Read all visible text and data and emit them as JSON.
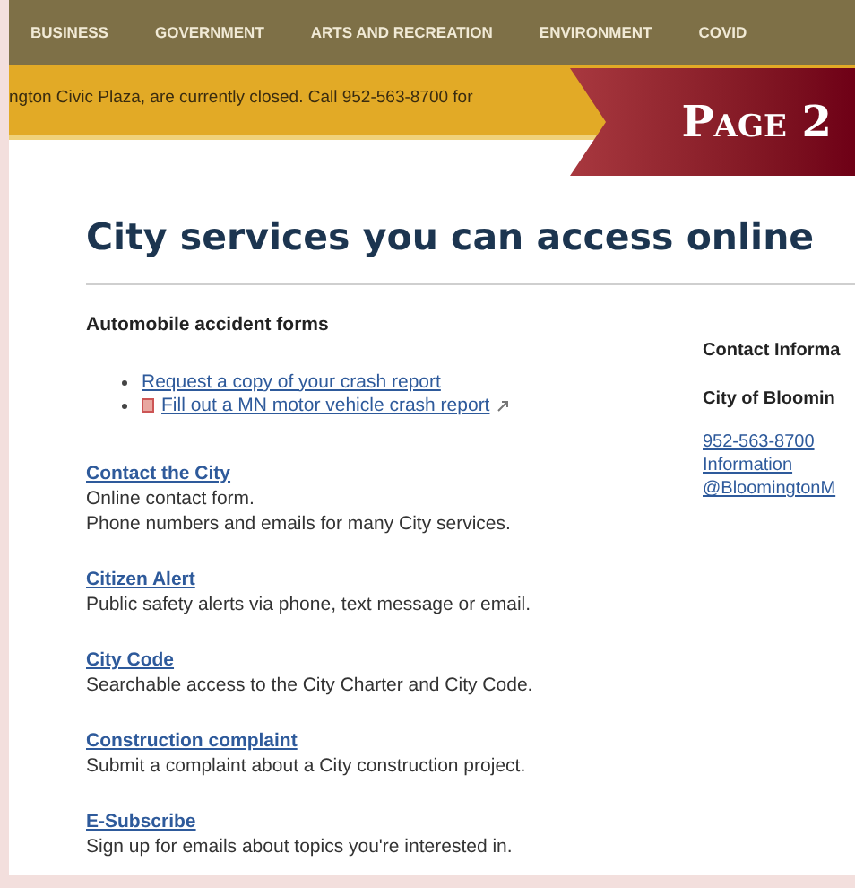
{
  "nav": [
    "BUSINESS",
    "GOVERNMENT",
    "ARTS AND RECREATION",
    "ENVIRONMENT",
    "COVID"
  ],
  "alert": "ngton Civic Plaza, are currently closed. Call 952-563-8700 for",
  "page_badge": "Page 2",
  "heading": "City services you can access online",
  "forms": {
    "title": "Automobile accident forms",
    "links": [
      {
        "label": "Request a copy of your crash report",
        "kind": "plain"
      },
      {
        "label": "Fill out a MN motor vehicle crash report",
        "kind": "external"
      }
    ]
  },
  "services": [
    {
      "title": "Contact the City",
      "lines": [
        "Online contact form.",
        "Phone numbers and emails for many City services."
      ]
    },
    {
      "title": "Citizen Alert",
      "lines": [
        "Public safety alerts via phone, text message or email."
      ]
    },
    {
      "title": "City Code",
      "lines": [
        "Searchable access to the City Charter and City Code."
      ]
    },
    {
      "title": "Construction complaint",
      "lines": [
        "Submit a complaint about a City construction project."
      ]
    },
    {
      "title": "E-Subscribe",
      "lines": [
        "Sign up for emails about topics you're interested in."
      ]
    }
  ],
  "contact": {
    "title": "Contact Informa",
    "name": "City of Bloomin",
    "links": [
      "952-563-8700",
      "Information",
      "@BloomingtonM"
    ]
  }
}
